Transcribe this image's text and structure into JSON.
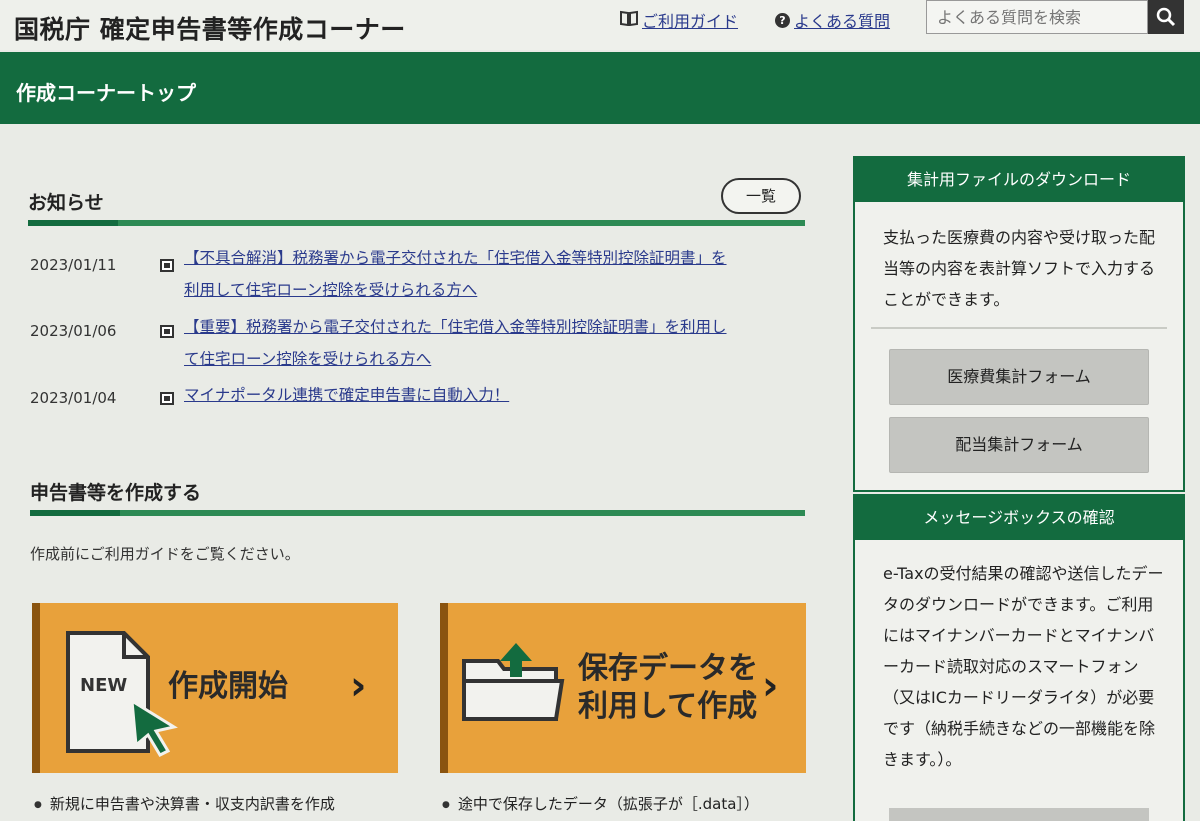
{
  "header": {
    "site_title": "国税庁 確定申告書等作成コーナー",
    "guide_link": "ご利用ガイド",
    "faq_link": "よくある質問",
    "search_placeholder": "よくある質問を検索"
  },
  "nav": {
    "title": "作成コーナートップ"
  },
  "notice": {
    "heading": "お知らせ",
    "list_button": "一覧",
    "items": [
      {
        "date": "2023/01/11",
        "line1": "【不具合解消】税務署から電子交付された「住宅借入金等特別控除証明書」を",
        "line2": "利用して住宅ローン控除を受けられる方へ"
      },
      {
        "date": "2023/01/06",
        "line1": "【重要】税務署から電子交付された「住宅借入金等特別控除証明書」を利用し",
        "line2": "て住宅ローン控除を受けられる方へ"
      },
      {
        "date": "2023/01/04",
        "line1": "マイナポータル連携で確定申告書に自動入力！",
        "line2": ""
      }
    ]
  },
  "create": {
    "heading": "申告書等を作成する",
    "intro": "作成前にご利用ガイドをご覧ください。",
    "card_new": {
      "badge": "NEW",
      "label": "作成開始",
      "note": "新規に申告書や決算書・収支内訳書を作成"
    },
    "card_saved": {
      "label_line1": "保存データを",
      "label_line2": "利用して作成",
      "note": "途中で保存したデータ（拡張子が［.data］）"
    }
  },
  "sidebar": {
    "download": {
      "heading": "集計用ファイルのダウンロード",
      "text": "支払った医療費の内容や受け取った配当等の内容を表計算ソフトで入力することができます。",
      "buttons": [
        "医療費集計フォーム",
        "配当集計フォーム"
      ]
    },
    "message": {
      "heading": "メッセージボックスの確認",
      "text": "e-Taxの受付結果の確認や送信したデータのダウンロードができます。ご利用にはマイナンバーカードとマイナンバーカード読取対応のスマートフォン（又はICカードリーダライタ）が必要です（納税手続きなどの一部機能を除きます。）。"
    }
  },
  "colors": {
    "brand_green": "#136b3f",
    "card_orange": "#e8a13b",
    "link_blue": "#2a3a8c"
  }
}
